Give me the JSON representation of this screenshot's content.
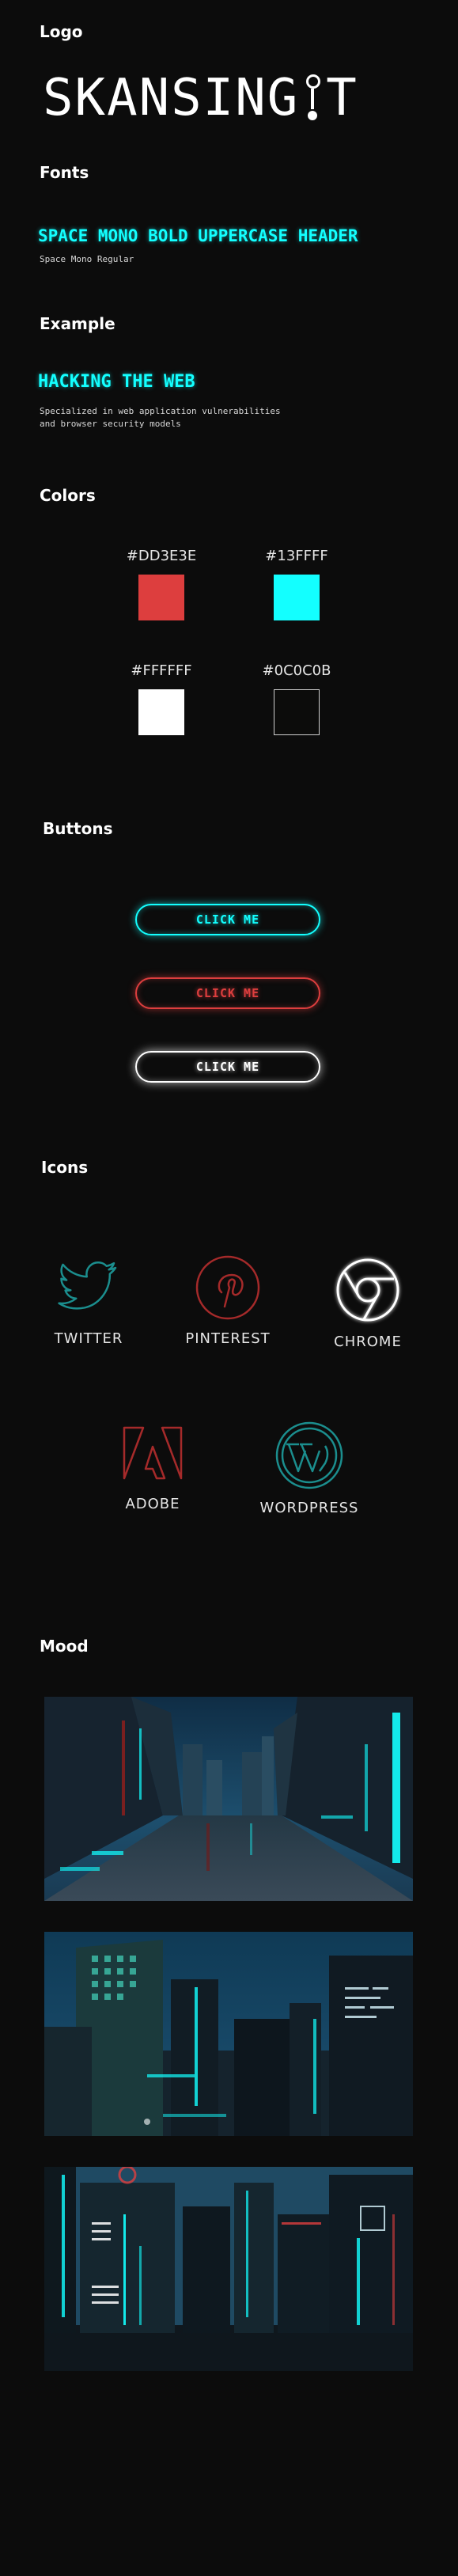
{
  "sections": {
    "logo": "Logo",
    "fonts": "Fonts",
    "example": "Example",
    "colors": "Colors",
    "buttons": "Buttons",
    "icons": "Icons",
    "mood": "Mood"
  },
  "logo": {
    "part1": "SKANSING",
    "part2": "T",
    "icon": "i-with-ring-icon"
  },
  "fonts": {
    "header_sample": "SPACE MONO BOLD UPPERCASE HEADER",
    "regular_sample": "Space Mono Regular"
  },
  "example": {
    "headline": "HACKING THE WEB",
    "body_line1": "Specialized in web application vulnerabilities",
    "body_line2": "and browser security models"
  },
  "colors": [
    {
      "label": "#DD3E3E",
      "hex": "#DD3E3E"
    },
    {
      "label": "#13FFFF",
      "hex": "#13FFFF"
    },
    {
      "label": "#FFFFFF",
      "hex": "#FFFFFF"
    },
    {
      "label": "#0C0C0B",
      "hex": "#0C0C0B"
    }
  ],
  "buttons": [
    {
      "label": "CLICK ME",
      "color": "#13FFFF"
    },
    {
      "label": "CLICK ME",
      "color": "#DD3E3E"
    },
    {
      "label": "CLICK ME",
      "color": "#FFFFFF"
    }
  ],
  "icons": [
    {
      "label": "TWITTER",
      "icon": "twitter-icon",
      "color": "#1b8e8e"
    },
    {
      "label": "PINTEREST",
      "icon": "pinterest-icon",
      "color": "#a52a2a"
    },
    {
      "label": "CHROME",
      "icon": "chrome-icon",
      "color": "#ffffff"
    },
    {
      "label": "ADOBE",
      "icon": "adobe-icon",
      "color": "#a52a2a"
    },
    {
      "label": "WORDPRESS",
      "icon": "wordpress-icon",
      "color": "#1b8e8e"
    }
  ],
  "mood_images": [
    "city-street-image",
    "city-towers-image",
    "neon-skyline-image"
  ]
}
